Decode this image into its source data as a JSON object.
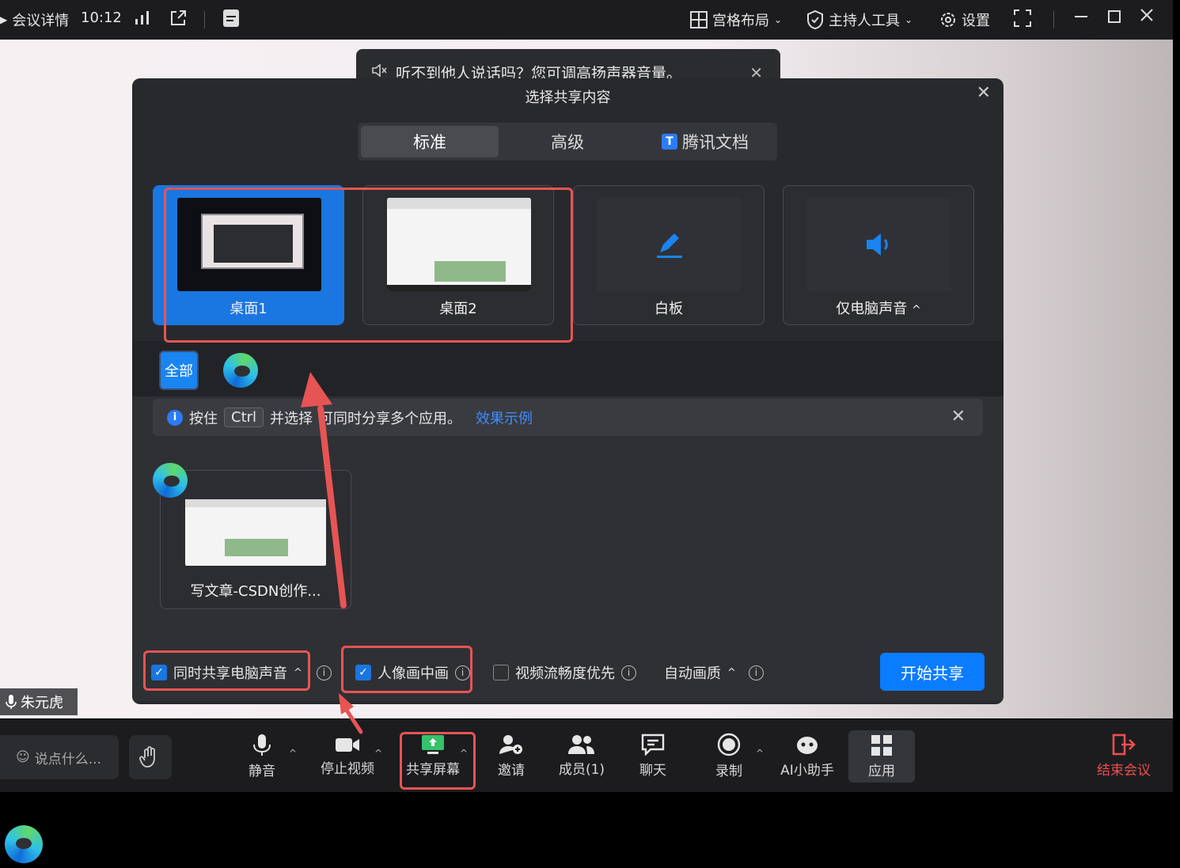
{
  "topbar": {
    "meeting_details": "会议详情",
    "time": "10:12",
    "layout": "宫格布局",
    "host_tools": "主持人工具",
    "settings": "设置"
  },
  "notice": {
    "text": "听不到他人说话吗？您可调高扬声器音量。"
  },
  "dialog": {
    "title": "选择共享内容",
    "tabs": [
      {
        "label": "标准"
      },
      {
        "label": "高级"
      },
      {
        "label": "腾讯文档"
      }
    ],
    "sources": [
      {
        "label": "桌面1"
      },
      {
        "label": "桌面2"
      },
      {
        "label": "白板"
      },
      {
        "label": "仅电脑声音"
      }
    ],
    "all_button": "全部",
    "info": {
      "prefix": "按住",
      "key": "Ctrl",
      "middle": "并选择",
      "suffix": "可同时分享多个应用。",
      "link": "效果示例"
    },
    "app_window": {
      "label": "写文章-CSDN创作..."
    },
    "options": {
      "share_audio": "同时共享电脑声音",
      "pip": "人像画中画",
      "smooth": "视频流畅度优先",
      "quality": "自动画质"
    },
    "start_button": "开始共享"
  },
  "participant": {
    "name": "朱元虎"
  },
  "toolbar": {
    "talk_placeholder": "说点什么...",
    "mute": "静音",
    "stop_video": "停止视频",
    "share_screen": "共享屏幕",
    "invite": "邀请",
    "members": "成员(1)",
    "chat": "聊天",
    "record": "录制",
    "ai": "AI小助手",
    "apps": "应用",
    "end": "结束会议"
  },
  "colors": {
    "accent": "#1a76e0",
    "annotation": "#e75454",
    "end_red": "#ef4e4e"
  }
}
